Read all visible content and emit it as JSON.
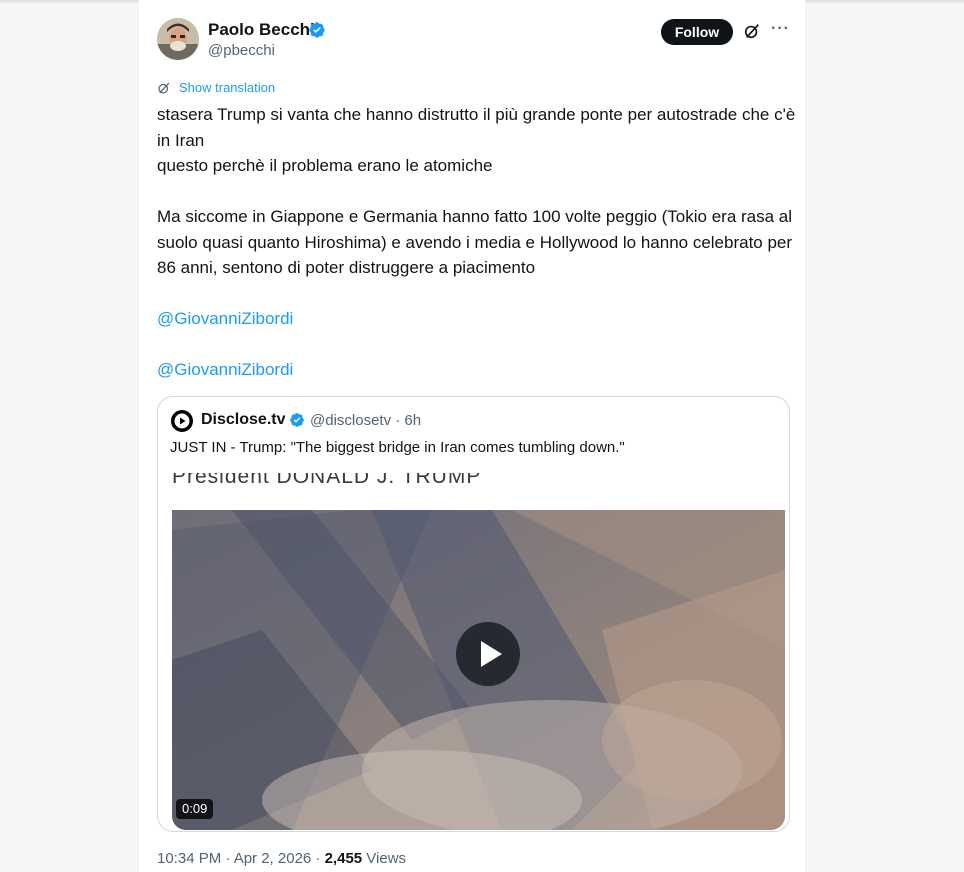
{
  "author": {
    "name": "Paolo Becchi",
    "handle": "@pbecchi",
    "verified": true,
    "avatar_icon": "profile-photo"
  },
  "actions": {
    "follow_label": "Follow",
    "grok_icon": "grok-icon",
    "more_label": "···"
  },
  "translate": {
    "label": "Show translation"
  },
  "tweet": {
    "line1": "stasera Trump si vanta che hanno distrutto il più grande ponte per autostrade che c'è in Iran",
    "line2": "questo perchè il problema erano le atomiche",
    "line3": "Ma siccome in Giappone e Germania hanno fatto 100 volte peggio (Tokio era rasa al suolo quasi quanto Hiroshima) e avendo i media e Hollywood lo hanno celebrato per 86 anni, sentono di poter distruggere a piacimento",
    "mention1": "@GiovanniZibordi",
    "mention2": "@GiovanniZibordi"
  },
  "quote": {
    "name": "Disclose.tv",
    "handle_time": "@disclosetv · 6h",
    "verified": true,
    "text": "JUST IN - Trump: \"The biggest bridge in Iran comes tumbling down.\"",
    "caption": "President DONALD J. TRUMP",
    "video_duration": "0:09"
  },
  "meta": {
    "time": "10:34 PM · Apr 2, 2026 · ",
    "views_count": "2,455",
    "views_label": " Views"
  },
  "colors": {
    "link": "#1d9bf0",
    "text": "#0f1419",
    "secondary": "#536471",
    "verified": "#1d9bf0"
  }
}
